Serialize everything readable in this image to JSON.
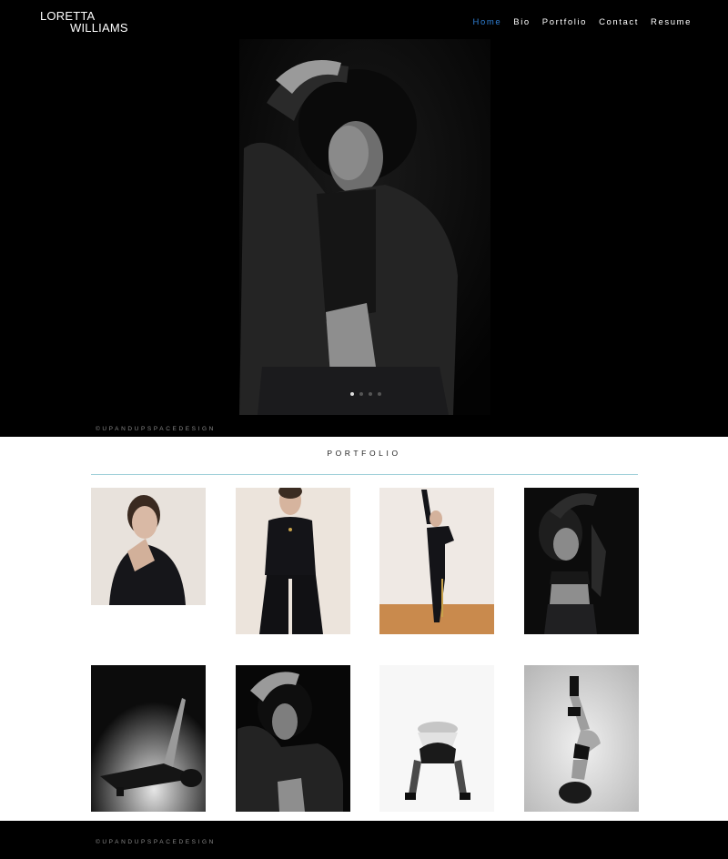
{
  "header": {
    "brand_line1": "LORETTA",
    "brand_line2": "WILLIAMS",
    "nav": [
      {
        "label": "Home",
        "active": true
      },
      {
        "label": "Bio",
        "active": false
      },
      {
        "label": "Portfolio",
        "active": false
      },
      {
        "label": "Contact",
        "active": false
      },
      {
        "label": "Resume",
        "active": false
      }
    ],
    "accent_color": "#2f7fd3"
  },
  "hero": {
    "slide_count": 4,
    "active_slide": 1,
    "photo": "model-portrait-dark-jacket",
    "credit": "©UPANDUPSPACEDESIGN"
  },
  "portfolio": {
    "title": "PORTFOLIO",
    "rule_color": "#9dcfd8",
    "thumbnails": [
      {
        "photo": "portrait-hand-on-chin"
      },
      {
        "photo": "standing-black-turtleneck"
      },
      {
        "photo": "arm-raised-wall-pose"
      },
      {
        "photo": "crop-top-arm-over-head"
      },
      {
        "photo": "floor-lean-pose"
      },
      {
        "photo": "dark-jacket-portrait"
      },
      {
        "photo": "inverted-bend-pose"
      },
      {
        "photo": "headstand-pose"
      }
    ]
  },
  "footer": {
    "credit": "©UPANDUPSPACEDESIGN"
  }
}
